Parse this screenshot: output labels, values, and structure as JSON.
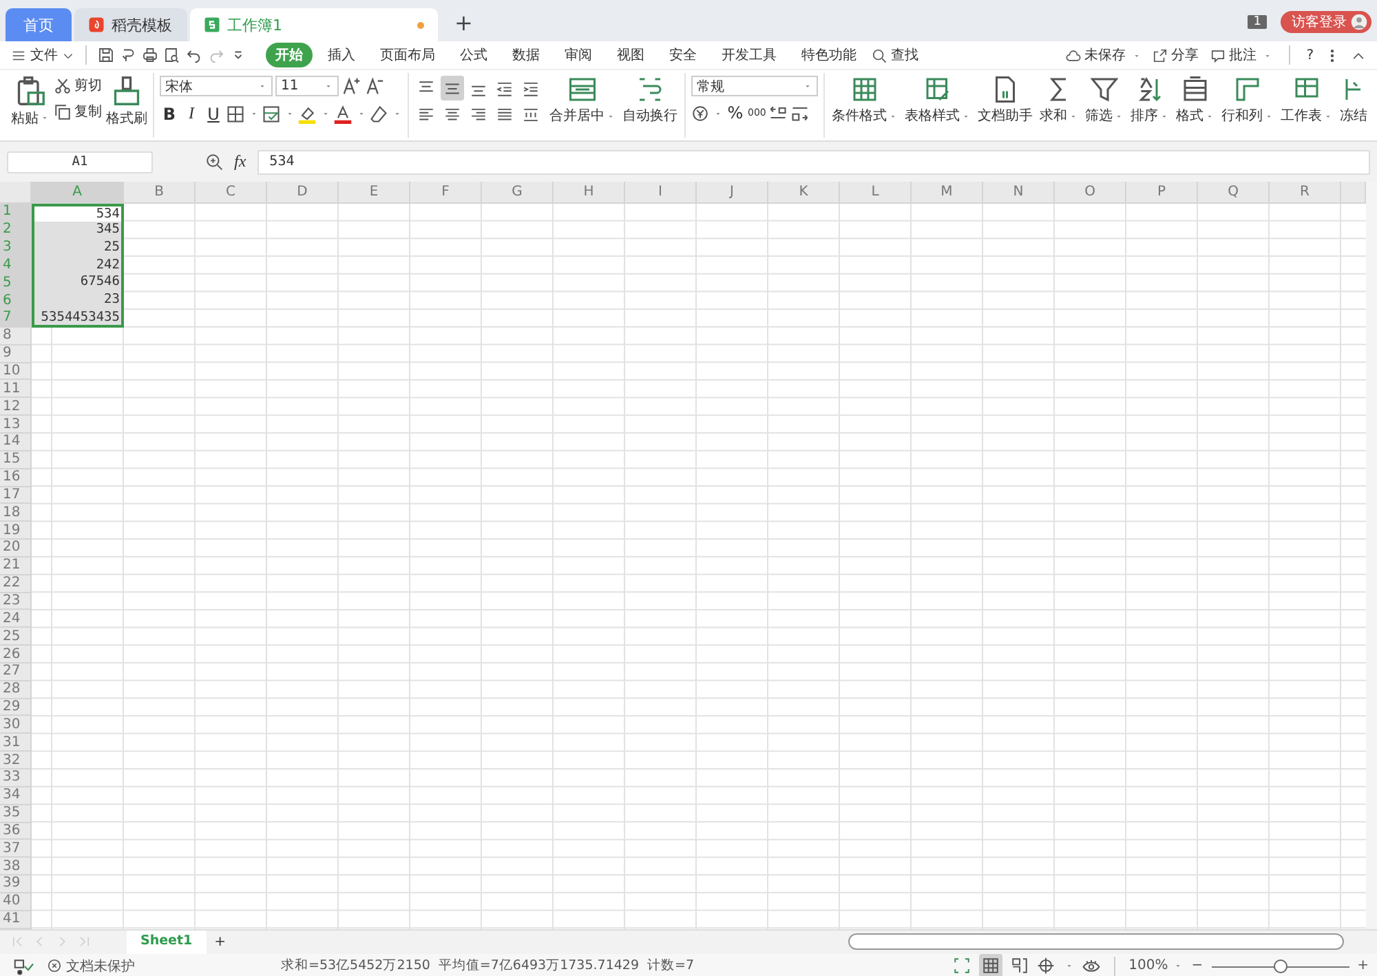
{
  "title_bar": {
    "tabs": [
      {
        "label": "首页",
        "kind": "home",
        "selected": false,
        "unsaved": false
      },
      {
        "label": "稻壳模板",
        "kind": "template",
        "selected": false,
        "unsaved": false
      },
      {
        "label": "工作簿1",
        "kind": "sheet",
        "selected": true,
        "unsaved": true
      }
    ],
    "new_tab": "+",
    "window_count": "1",
    "login_button": "访客登录"
  },
  "menu_bar": {
    "file_menu": "文件",
    "ribbon_tabs": [
      {
        "label": "开始",
        "selected": true
      },
      {
        "label": "插入",
        "selected": false
      },
      {
        "label": "页面布局",
        "selected": false
      },
      {
        "label": "公式",
        "selected": false
      },
      {
        "label": "数据",
        "selected": false
      },
      {
        "label": "审阅",
        "selected": false
      },
      {
        "label": "视图",
        "selected": false
      },
      {
        "label": "安全",
        "selected": false
      },
      {
        "label": "开发工具",
        "selected": false
      },
      {
        "label": "特色功能",
        "selected": false
      }
    ],
    "search": "查找",
    "actions": [
      "未保存",
      "分享",
      "批注"
    ],
    "help": "?"
  },
  "ribbon": {
    "clipboard": {
      "paste": "粘贴",
      "cut": "剪切",
      "copy": "复制",
      "format_painter": "格式刷"
    },
    "font": {
      "name": "宋体",
      "size": "11",
      "styles": [
        "B",
        "I",
        "U"
      ]
    },
    "alignment": {
      "buttons": [
        {
          "selected": false
        },
        {
          "selected": true
        },
        {
          "selected": false
        },
        {
          "selected": false
        },
        {
          "selected": false
        },
        {
          "selected": false
        },
        {
          "selected": false
        },
        {
          "selected": false
        },
        {
          "selected": false
        },
        {
          "selected": false
        }
      ],
      "merge": "合并居中",
      "wrap": "自动换行"
    },
    "number": {
      "format": "常规",
      "percent": "%",
      "thousands": "000"
    },
    "tools": [
      {
        "label": "条件格式",
        "dropdown": true
      },
      {
        "label": "表格样式",
        "dropdown": true
      },
      {
        "label": "文档助手",
        "dropdown": false
      },
      {
        "label": "求和",
        "dropdown": true
      },
      {
        "label": "筛选",
        "dropdown": true
      },
      {
        "label": "排序",
        "dropdown": true
      },
      {
        "label": "格式",
        "dropdown": true
      },
      {
        "label": "行和列",
        "dropdown": true
      },
      {
        "label": "工作表",
        "dropdown": true
      },
      {
        "label": "冻结",
        "dropdown": false
      }
    ]
  },
  "formula_bar": {
    "name_box": "A1",
    "function": "fx",
    "formula": "534"
  },
  "grid": {
    "columns": [
      {
        "label": "A",
        "selected": true
      },
      {
        "label": "B",
        "selected": false
      },
      {
        "label": "C",
        "selected": false
      },
      {
        "label": "D",
        "selected": false
      },
      {
        "label": "E",
        "selected": false
      },
      {
        "label": "F",
        "selected": false
      },
      {
        "label": "G",
        "selected": false
      },
      {
        "label": "H",
        "selected": false
      },
      {
        "label": "I",
        "selected": false
      },
      {
        "label": "J",
        "selected": false
      },
      {
        "label": "K",
        "selected": false
      },
      {
        "label": "L",
        "selected": false
      },
      {
        "label": "M",
        "selected": false
      },
      {
        "label": "N",
        "selected": false
      },
      {
        "label": "O",
        "selected": false
      },
      {
        "label": "P",
        "selected": false
      },
      {
        "label": "Q",
        "selected": false
      },
      {
        "label": "R",
        "selected": false
      }
    ],
    "rows": [
      {
        "label": "1",
        "selected": true,
        "cells": [
          {
            "value": "534",
            "active": true
          }
        ]
      },
      {
        "label": "2",
        "selected": true,
        "cells": [
          {
            "value": "345",
            "active": false
          }
        ]
      },
      {
        "label": "3",
        "selected": true,
        "cells": [
          {
            "value": "25",
            "active": false
          }
        ]
      },
      {
        "label": "4",
        "selected": true,
        "cells": [
          {
            "value": "242",
            "active": false
          }
        ]
      },
      {
        "label": "5",
        "selected": true,
        "cells": [
          {
            "value": "67546",
            "active": false
          }
        ]
      },
      {
        "label": "6",
        "selected": true,
        "cells": [
          {
            "value": "23",
            "active": false
          }
        ]
      },
      {
        "label": "7",
        "selected": true,
        "cells": [
          {
            "value": "5354453435",
            "active": false
          }
        ]
      },
      {
        "label": "8",
        "selected": false
      },
      {
        "label": "9",
        "selected": false
      },
      {
        "label": "10",
        "selected": false
      },
      {
        "label": "11",
        "selected": false
      },
      {
        "label": "12",
        "selected": false
      },
      {
        "label": "13",
        "selected": false
      },
      {
        "label": "14",
        "selected": false
      },
      {
        "label": "15",
        "selected": false
      },
      {
        "label": "16",
        "selected": false
      },
      {
        "label": "17",
        "selected": false
      },
      {
        "label": "18",
        "selected": false
      },
      {
        "label": "19",
        "selected": false
      },
      {
        "label": "20",
        "selected": false
      },
      {
        "label": "21",
        "selected": false
      },
      {
        "label": "22",
        "selected": false
      },
      {
        "label": "23",
        "selected": false
      },
      {
        "label": "24",
        "selected": false
      },
      {
        "label": "25",
        "selected": false
      },
      {
        "label": "26",
        "selected": false
      },
      {
        "label": "27",
        "selected": false
      },
      {
        "label": "28",
        "selected": false
      },
      {
        "label": "29",
        "selected": false
      },
      {
        "label": "30",
        "selected": false
      },
      {
        "label": "31",
        "selected": false
      },
      {
        "label": "32",
        "selected": false
      },
      {
        "label": "33",
        "selected": false
      },
      {
        "label": "34",
        "selected": false
      },
      {
        "label": "35",
        "selected": false
      },
      {
        "label": "36",
        "selected": false
      },
      {
        "label": "37",
        "selected": false
      },
      {
        "label": "38",
        "selected": false
      },
      {
        "label": "39",
        "selected": false
      },
      {
        "label": "40",
        "selected": false
      },
      {
        "label": "41",
        "selected": false
      }
    ]
  },
  "sheet_tabs": [
    {
      "label": "Sheet1",
      "selected": true
    }
  ],
  "add_sheet": "+",
  "status_bar": {
    "protection": "文档未保护",
    "sum": "求和=53亿5452万2150",
    "average": "平均值=7亿6493万1735.71429",
    "count": "计数=7",
    "zoom": "100%",
    "zoom_out": "−",
    "zoom_in": "+",
    "zoom_slider": {
      "level": 0.5
    }
  }
}
